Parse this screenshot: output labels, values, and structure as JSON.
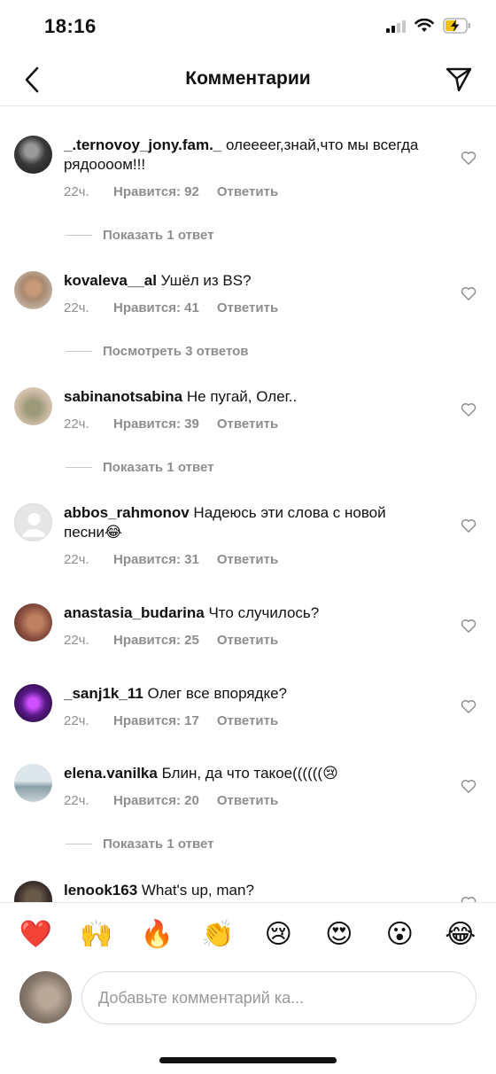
{
  "status_bar": {
    "time": "18:16"
  },
  "header": {
    "title": "Комментарии",
    "back_icon": "chevron-left-icon",
    "send_icon": "paper-plane-icon"
  },
  "comments": [
    {
      "username": "_.ternovoy_jony.fam._",
      "text": " олеееег,знай,что мы всегда рядоооом!!!",
      "time": "22ч.",
      "likes": "Нравится: 92",
      "reply": "Ответить",
      "replies_label": "Показать 1 ответ"
    },
    {
      "username": "kovaleva__al",
      "text": " Ушёл из BS?",
      "time": "22ч.",
      "likes": "Нравится: 41",
      "reply": "Ответить",
      "replies_label": "Посмотреть 3 ответов"
    },
    {
      "username": "sabinanotsabina",
      "text": " Не пугай, Олег..",
      "time": "22ч.",
      "likes": "Нравится: 39",
      "reply": "Ответить",
      "replies_label": "Показать 1 ответ"
    },
    {
      "username": "abbos_rahmonov",
      "text": " Надеюсь эти слова с новой песни😂",
      "time": "22ч.",
      "likes": "Нравится: 31",
      "reply": "Ответить",
      "replies_label": ""
    },
    {
      "username": "anastasia_budarina",
      "text": " Что случилось?",
      "time": "22ч.",
      "likes": "Нравится: 25",
      "reply": "Ответить",
      "replies_label": ""
    },
    {
      "username": "_sanj1k_11",
      "text": " Олег все впорядке?",
      "time": "22ч.",
      "likes": "Нравится: 17",
      "reply": "Ответить",
      "replies_label": ""
    },
    {
      "username": "elena.vanilka",
      "text": " Блин, да что такое((((((😢",
      "time": "22ч.",
      "likes": "Нравится: 20",
      "reply": "Ответить",
      "replies_label": "Показать 1 ответ"
    },
    {
      "username": "lenook163",
      "text": " What's up, man?",
      "time": "",
      "likes": "",
      "reply": "",
      "replies_label": ""
    }
  ],
  "emoji_bar": [
    "❤️",
    "🙌",
    "🔥",
    "👏",
    "😢",
    "😍",
    "😮",
    "😂"
  ],
  "input": {
    "placeholder": "Добавьте комментарий ка..."
  },
  "colors": {
    "text": "#111111",
    "secondary": "#8e8e8e",
    "divider": "#e6e6e6"
  }
}
